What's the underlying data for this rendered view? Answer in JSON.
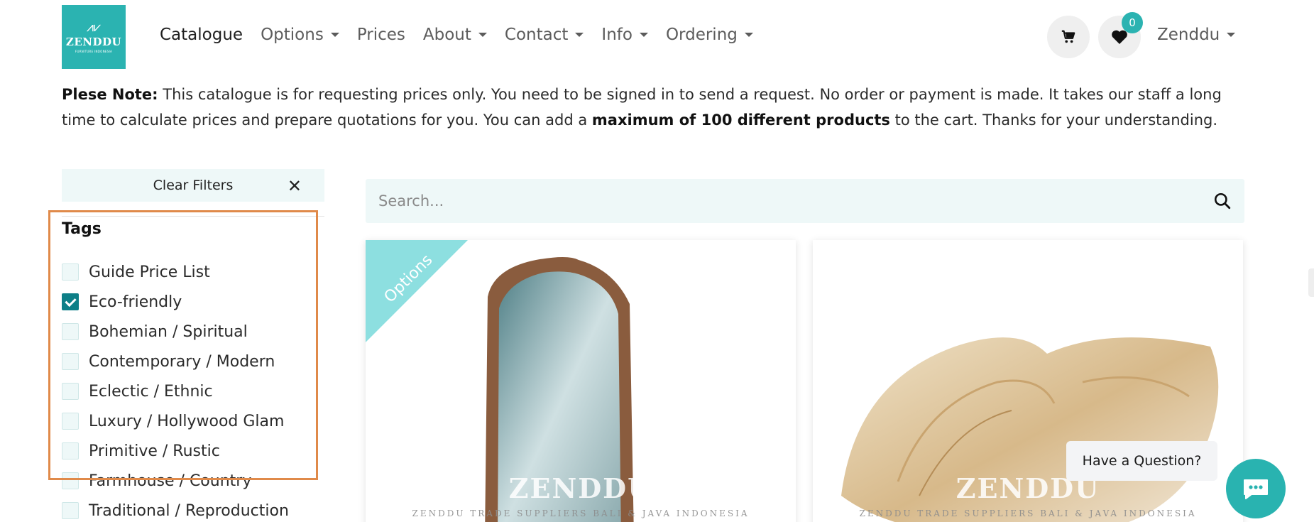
{
  "brand": {
    "mark": "⩘⩗",
    "name": "ZENDDU",
    "tagline": "FURNITURE INDONESIA"
  },
  "nav": {
    "items": [
      {
        "label": "Catalogue",
        "dropdown": false
      },
      {
        "label": "Options",
        "dropdown": true
      },
      {
        "label": "Prices",
        "dropdown": false
      },
      {
        "label": "About",
        "dropdown": true
      },
      {
        "label": "Contact",
        "dropdown": true
      },
      {
        "label": "Info",
        "dropdown": true
      },
      {
        "label": "Ordering",
        "dropdown": true
      }
    ],
    "wishlist_count": "0",
    "user_label": "Zenddu"
  },
  "note": {
    "label": "Plese Note:",
    "text_1": "This catalogue is for requesting prices only. You need to be signed in to send a request. No order or payment is made. It takes our staff a long time to calculate prices and prepare quotations for you. You can add a",
    "emphasis": "maximum of 100 different products",
    "text_2": "to the cart. Thanks for your understanding."
  },
  "filters": {
    "clear_label": "Clear Filters",
    "clear_icon": "✕",
    "tags_title": "Tags",
    "tags": [
      {
        "label": "Guide Price List",
        "checked": false
      },
      {
        "label": "Eco-friendly",
        "checked": true
      },
      {
        "label": "Bohemian / Spiritual",
        "checked": false
      },
      {
        "label": "Contemporary / Modern",
        "checked": false
      },
      {
        "label": "Eclectic / Ethnic",
        "checked": false
      },
      {
        "label": "Luxury / Hollywood Glam",
        "checked": false
      },
      {
        "label": "Primitive / Rustic",
        "checked": false
      },
      {
        "label": "Farmhouse / Country",
        "checked": false
      },
      {
        "label": "Traditional / Reproduction",
        "checked": false
      }
    ]
  },
  "search": {
    "placeholder": "Search..."
  },
  "products": [
    {
      "ribbon": "Options",
      "watermark_name": "ZENDDU",
      "watermark_sub": "ZENDDU TRADE SUPPLIERS   BALI & JAVA INDONESIA"
    },
    {
      "ribbon": "",
      "watermark_name": "ZENDDU",
      "watermark_sub": "ZENDDU TRADE SUPPLIERS   BALI & JAVA INDONESIA"
    }
  ],
  "chat": {
    "question_label": "Have a Question?"
  },
  "colors": {
    "accent": "#2bb3b1",
    "checkbox_checked": "#0d7f87",
    "ribbon": "#8ddfe0",
    "highlight": "#e08a4a"
  }
}
